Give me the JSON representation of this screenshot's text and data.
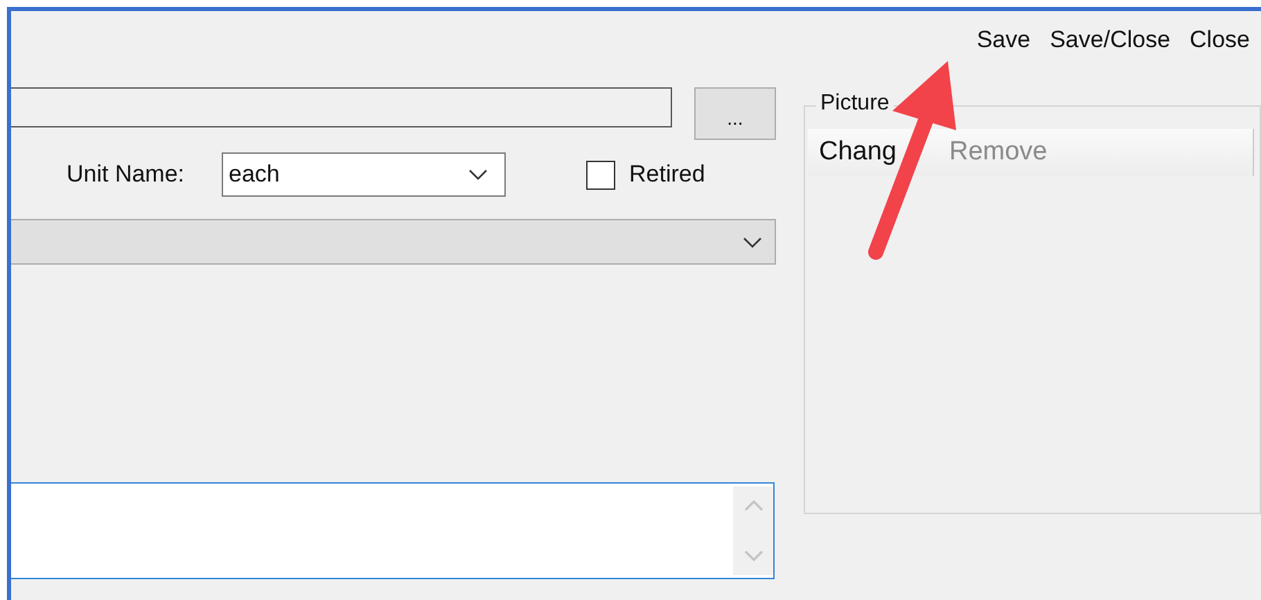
{
  "toolbar": {
    "buttons": [
      {
        "label": "Save"
      },
      {
        "label": "Save/Close"
      },
      {
        "label": "Close"
      }
    ]
  },
  "form": {
    "browse_button": {
      "label": "..."
    },
    "unit_name": {
      "label": "Unit Name:",
      "value": "each"
    },
    "retired": {
      "label": "Retired",
      "checked": false
    },
    "category_combo": {
      "disabled": true
    },
    "notes": {
      "focused": true
    }
  },
  "picture_group": {
    "title": "Picture",
    "actions": [
      {
        "label": "Chang",
        "disabled": false
      },
      {
        "label": "Remove",
        "disabled": true
      }
    ]
  }
}
